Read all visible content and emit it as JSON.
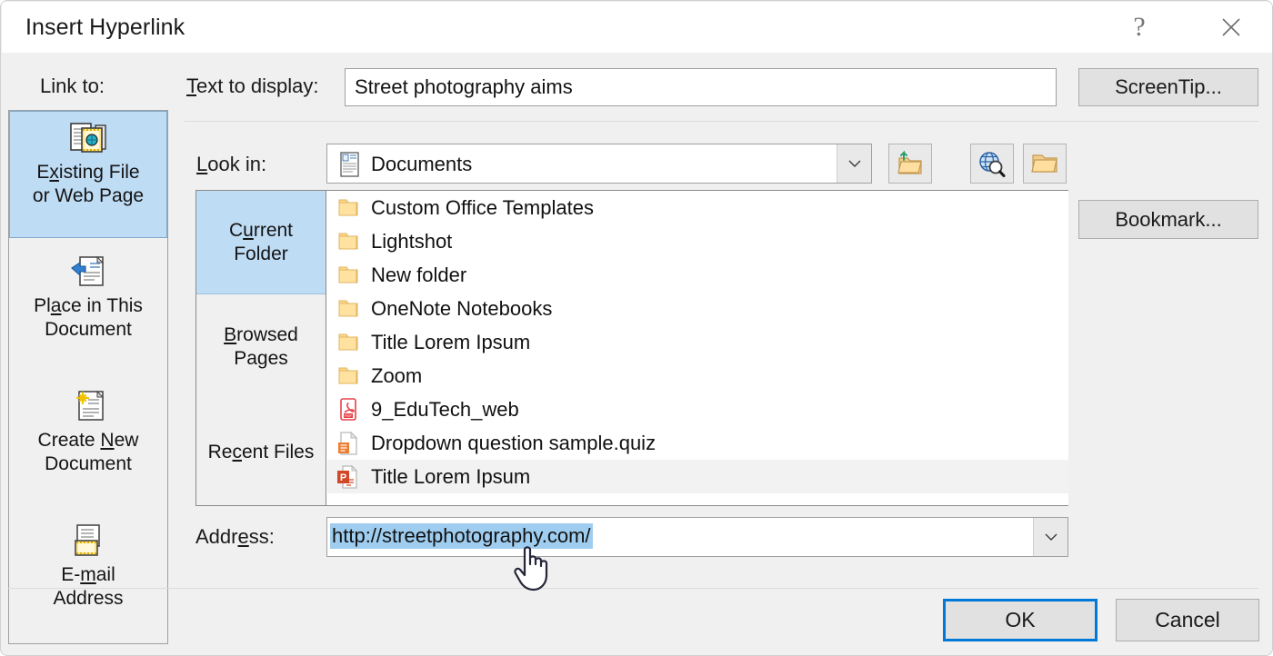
{
  "window": {
    "title": "Insert Hyperlink",
    "help_icon": "question-mark-icon",
    "close_icon": "close-icon"
  },
  "link_to": {
    "label": "Link to:",
    "items": [
      {
        "label_pre": "E",
        "label_accel": "x",
        "label_post": "isting File\nor Web Page",
        "icon": "existing-file-or-web-page-icon",
        "selected": true
      },
      {
        "label_pre": "Pl",
        "label_accel": "a",
        "label_post": "ce in This\nDocument",
        "icon": "place-in-this-document-icon",
        "selected": false
      },
      {
        "label_pre": "Create ",
        "label_accel": "N",
        "label_post": "ew\nDocument",
        "icon": "create-new-document-icon",
        "selected": false
      },
      {
        "label_pre": "E-",
        "label_accel": "m",
        "label_post": "ail\nAddress",
        "icon": "email-address-icon",
        "selected": false
      }
    ]
  },
  "text_to_display": {
    "label_pre": "",
    "label_accel": "T",
    "label_post": "ext to display:",
    "value": "Street photography aims"
  },
  "buttons": {
    "screentip": "ScreenTip...",
    "bookmark": "Bookmark...",
    "ok": "OK",
    "cancel": "Cancel"
  },
  "look_in": {
    "label_pre": "",
    "label_accel": "L",
    "label_post": "ook in:",
    "value": "Documents",
    "icon": "documents-folder-icon",
    "dropdown_icon": "chevron-down-icon",
    "toolbar": [
      {
        "name": "up-one-folder-button",
        "icon": "up-one-folder-icon"
      },
      {
        "name": "browse-the-web-button",
        "icon": "browse-web-icon"
      },
      {
        "name": "browse-for-file-button",
        "icon": "browse-file-folder-icon"
      }
    ]
  },
  "browser": {
    "tabs": [
      {
        "label_pre": "C",
        "label_accel": "u",
        "label_post": "rrent\nFolder",
        "selected": true
      },
      {
        "label_pre": "",
        "label_accel": "B",
        "label_post": "rowsed\nPages",
        "selected": false
      },
      {
        "label_pre": "Re",
        "label_accel": "c",
        "label_post": "ent Files",
        "selected": false
      }
    ],
    "files": [
      {
        "name": "Custom Office Templates",
        "icon": "folder-icon",
        "type": "folder",
        "selected": false
      },
      {
        "name": "Lightshot",
        "icon": "folder-icon",
        "type": "folder",
        "selected": false
      },
      {
        "name": "New folder",
        "icon": "folder-icon",
        "type": "folder",
        "selected": false
      },
      {
        "name": "OneNote Notebooks",
        "icon": "folder-icon",
        "type": "folder",
        "selected": false
      },
      {
        "name": "Title Lorem Ipsum",
        "icon": "folder-icon",
        "type": "folder",
        "selected": false
      },
      {
        "name": "Zoom",
        "icon": "folder-icon",
        "type": "folder",
        "selected": false
      },
      {
        "name": "9_EduTech_web",
        "icon": "pdf-file-icon",
        "type": "pdf",
        "selected": false
      },
      {
        "name": "Dropdown question sample.quiz",
        "icon": "quiz-file-icon",
        "type": "quiz",
        "selected": false
      },
      {
        "name": "Title Lorem Ipsum",
        "icon": "powerpoint-file-icon",
        "type": "powerpoint",
        "selected": true
      }
    ]
  },
  "address": {
    "label_pre": "Addr",
    "label_accel": "e",
    "label_post": "ss:",
    "value": "http://streetphotography.com/",
    "selected": true,
    "dropdown_icon": "chevron-down-icon"
  },
  "colors": {
    "accent": "#0078d7",
    "selection_blue": "#bfdcf5",
    "text_selection": "#9fcdf0",
    "dialog_bg": "#f0f0f0",
    "button_face": "#e1e1e1"
  },
  "cursor": {
    "icon": "hand-pointer-cursor"
  }
}
